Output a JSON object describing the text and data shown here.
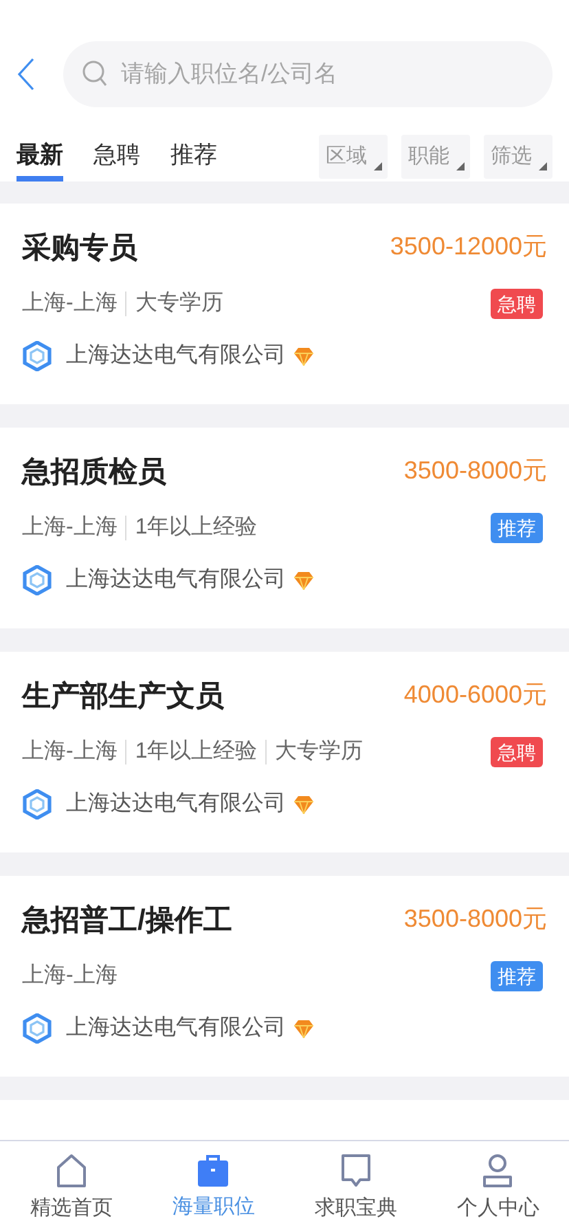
{
  "search": {
    "placeholder": "请输入职位名/公司名"
  },
  "tabs": [
    {
      "label": "最新",
      "selected": true
    },
    {
      "label": "急聘",
      "selected": false
    },
    {
      "label": "推荐",
      "selected": false
    }
  ],
  "filters": [
    "区域",
    "职能",
    "筛选"
  ],
  "jobs": [
    {
      "title": "采购专员",
      "salary": "3500-12000元",
      "meta": [
        "上海-上海",
        "大专学历"
      ],
      "tag": {
        "text": "急聘",
        "color": "#f04a4f"
      },
      "company": "上海达达电气有限公司"
    },
    {
      "title": "急招质检员",
      "salary": "3500-8000元",
      "meta": [
        "上海-上海",
        "1年以上经验"
      ],
      "tag": {
        "text": "推荐",
        "color": "#3f8ef0"
      },
      "company": "上海达达电气有限公司"
    },
    {
      "title": "生产部生产文员",
      "salary": "4000-6000元",
      "meta": [
        "上海-上海",
        "1年以上经验",
        "大专学历"
      ],
      "tag": {
        "text": "急聘",
        "color": "#f04a4f"
      },
      "company": "上海达达电气有限公司"
    },
    {
      "title": "急招普工/操作工",
      "salary": "3500-8000元",
      "meta": [
        "上海-上海"
      ],
      "tag": {
        "text": "推荐",
        "color": "#3f8ef0"
      },
      "company": "上海达达电气有限公司"
    }
  ],
  "nav": [
    {
      "label": "精选首页",
      "selected": false
    },
    {
      "label": "海量职位",
      "selected": true
    },
    {
      "label": "求职宝典",
      "selected": false
    },
    {
      "label": "个人中心",
      "selected": false
    }
  ]
}
